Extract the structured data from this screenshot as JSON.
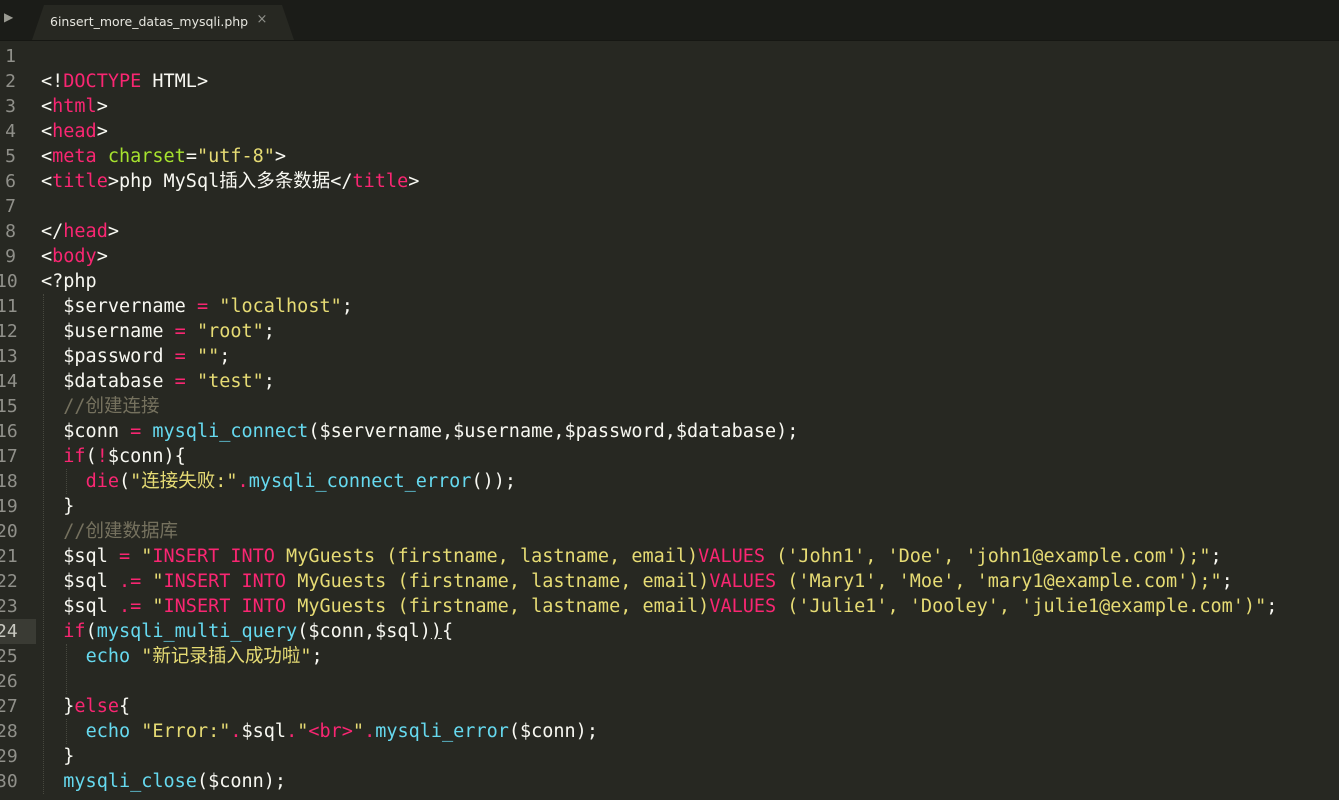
{
  "tab": {
    "title": "6insert_more_datas_mysqli.php",
    "close_glyph": "×",
    "toggle_glyph": "▶"
  },
  "editor": {
    "active_line": 24,
    "lines": [
      {
        "n": "1",
        "tokens": []
      },
      {
        "n": "2",
        "tokens": [
          [
            "punct",
            "<!"
          ],
          [
            "tag",
            "DOCTYPE"
          ],
          [
            "plain",
            " HTML>"
          ]
        ]
      },
      {
        "n": "3",
        "tokens": [
          [
            "punct",
            "<"
          ],
          [
            "tag",
            "html"
          ],
          [
            "punct",
            ">"
          ]
        ]
      },
      {
        "n": "4",
        "tokens": [
          [
            "punct",
            "<"
          ],
          [
            "tag",
            "head"
          ],
          [
            "punct",
            ">"
          ]
        ]
      },
      {
        "n": "5",
        "tokens": [
          [
            "punct",
            "<"
          ],
          [
            "tag",
            "meta"
          ],
          [
            "plain",
            " "
          ],
          [
            "attr",
            "charset"
          ],
          [
            "punct",
            "="
          ],
          [
            "str",
            "\"utf-8\""
          ],
          [
            "punct",
            ">"
          ]
        ]
      },
      {
        "n": "6",
        "tokens": [
          [
            "punct",
            "<"
          ],
          [
            "tag",
            "title"
          ],
          [
            "punct",
            ">"
          ],
          [
            "plain",
            "php MySql插入多条数据"
          ],
          [
            "punct",
            "</"
          ],
          [
            "tag",
            "title"
          ],
          [
            "punct",
            ">"
          ]
        ]
      },
      {
        "n": "7",
        "tokens": []
      },
      {
        "n": "8",
        "tokens": [
          [
            "punct",
            "</"
          ],
          [
            "tag",
            "head"
          ],
          [
            "punct",
            ">"
          ]
        ]
      },
      {
        "n": "9",
        "tokens": [
          [
            "punct",
            "<"
          ],
          [
            "tag",
            "body"
          ],
          [
            "punct",
            ">"
          ]
        ]
      },
      {
        "n": "10",
        "tokens": [
          [
            "plain",
            "<?php"
          ]
        ]
      },
      {
        "n": "11",
        "tokens": [
          [
            "plain",
            "  $servername "
          ],
          [
            "op",
            "="
          ],
          [
            "plain",
            " "
          ],
          [
            "str",
            "\"localhost\""
          ],
          [
            "plain",
            ";"
          ]
        ]
      },
      {
        "n": "12",
        "tokens": [
          [
            "plain",
            "  $username "
          ],
          [
            "op",
            "="
          ],
          [
            "plain",
            " "
          ],
          [
            "str",
            "\"root\""
          ],
          [
            "plain",
            ";"
          ]
        ]
      },
      {
        "n": "13",
        "tokens": [
          [
            "plain",
            "  $password "
          ],
          [
            "op",
            "="
          ],
          [
            "plain",
            " "
          ],
          [
            "str",
            "\"\""
          ],
          [
            "plain",
            ";"
          ]
        ]
      },
      {
        "n": "14",
        "tokens": [
          [
            "plain",
            "  $database "
          ],
          [
            "op",
            "="
          ],
          [
            "plain",
            " "
          ],
          [
            "str",
            "\"test\""
          ],
          [
            "plain",
            ";"
          ]
        ]
      },
      {
        "n": "15",
        "tokens": [
          [
            "plain",
            "  "
          ],
          [
            "cmt",
            "//创建连接"
          ]
        ]
      },
      {
        "n": "16",
        "tokens": [
          [
            "plain",
            "  $conn "
          ],
          [
            "op",
            "="
          ],
          [
            "plain",
            " "
          ],
          [
            "fn",
            "mysqli_connect"
          ],
          [
            "plain",
            "($servername,$username,$password,$database);"
          ]
        ]
      },
      {
        "n": "17",
        "tokens": [
          [
            "plain",
            "  "
          ],
          [
            "kw",
            "if"
          ],
          [
            "plain",
            "("
          ],
          [
            "op",
            "!"
          ],
          [
            "plain",
            "$conn){"
          ]
        ]
      },
      {
        "n": "18",
        "tokens": [
          [
            "plain",
            "    "
          ],
          [
            "kw",
            "die"
          ],
          [
            "plain",
            "("
          ],
          [
            "str",
            "\"连接失败:\""
          ],
          [
            "op",
            "."
          ],
          [
            "fn",
            "mysqli_connect_error"
          ],
          [
            "plain",
            "());"
          ]
        ]
      },
      {
        "n": "19",
        "tokens": [
          [
            "plain",
            "  }"
          ]
        ]
      },
      {
        "n": "20",
        "tokens": [
          [
            "plain",
            "  "
          ],
          [
            "cmt",
            "//创建数据库"
          ]
        ]
      },
      {
        "n": "21",
        "tokens": [
          [
            "plain",
            "  $sql "
          ],
          [
            "op",
            "="
          ],
          [
            "plain",
            " "
          ],
          [
            "str",
            "\""
          ],
          [
            "kw",
            "INSERT INTO"
          ],
          [
            "str",
            " MyGuests (firstname, lastname, email)"
          ],
          [
            "kw",
            "VALUES"
          ],
          [
            "str",
            " ('John1', 'Doe', 'john1@example.com');\""
          ],
          [
            "plain",
            ";"
          ]
        ]
      },
      {
        "n": "22",
        "tokens": [
          [
            "plain",
            "  $sql "
          ],
          [
            "op",
            ".="
          ],
          [
            "plain",
            " "
          ],
          [
            "str",
            "\""
          ],
          [
            "kw",
            "INSERT INTO"
          ],
          [
            "str",
            " MyGuests (firstname, lastname, email)"
          ],
          [
            "kw",
            "VALUES"
          ],
          [
            "str",
            " ('Mary1', 'Moe', 'mary1@example.com');\""
          ],
          [
            "plain",
            ";"
          ]
        ]
      },
      {
        "n": "23",
        "tokens": [
          [
            "plain",
            "  $sql "
          ],
          [
            "op",
            ".="
          ],
          [
            "plain",
            " "
          ],
          [
            "str",
            "\""
          ],
          [
            "kw",
            "INSERT INTO"
          ],
          [
            "str",
            " MyGuests (firstname, lastname, email)"
          ],
          [
            "kw",
            "VALUES"
          ],
          [
            "str",
            " ('Julie1', 'Dooley', 'julie1@example.com')\""
          ],
          [
            "plain",
            ";"
          ]
        ]
      },
      {
        "n": "24",
        "tokens": [
          [
            "plain",
            "  "
          ],
          [
            "kw",
            "if"
          ],
          [
            "plain",
            "("
          ],
          [
            "fn",
            "mysqli_multi_query"
          ],
          [
            "plain",
            "($conn,$sql)"
          ],
          [
            "bracket",
            ")"
          ],
          [
            "plain",
            "{"
          ]
        ]
      },
      {
        "n": "25",
        "tokens": [
          [
            "plain",
            "    "
          ],
          [
            "fn",
            "echo"
          ],
          [
            "plain",
            " "
          ],
          [
            "str",
            "\"新记录插入成功啦\""
          ],
          [
            "plain",
            ";"
          ]
        ]
      },
      {
        "n": "26",
        "tokens": []
      },
      {
        "n": "27",
        "tokens": [
          [
            "plain",
            "  }"
          ],
          [
            "kw",
            "else"
          ],
          [
            "plain",
            "{"
          ]
        ]
      },
      {
        "n": "28",
        "tokens": [
          [
            "plain",
            "    "
          ],
          [
            "fn",
            "echo"
          ],
          [
            "plain",
            " "
          ],
          [
            "str",
            "\"Error:\""
          ],
          [
            "op",
            "."
          ],
          [
            "plain",
            "$sql"
          ],
          [
            "op",
            "."
          ],
          [
            "str",
            "\""
          ],
          [
            "tag",
            "<br>"
          ],
          [
            "str",
            "\""
          ],
          [
            "op",
            "."
          ],
          [
            "fn",
            "mysqli_error"
          ],
          [
            "plain",
            "($conn);"
          ]
        ]
      },
      {
        "n": "29",
        "tokens": [
          [
            "plain",
            "  }"
          ]
        ]
      },
      {
        "n": "30",
        "tokens": [
          [
            "plain",
            "  "
          ],
          [
            "fn",
            "mysqli_close"
          ],
          [
            "plain",
            "($conn);"
          ]
        ]
      }
    ]
  }
}
